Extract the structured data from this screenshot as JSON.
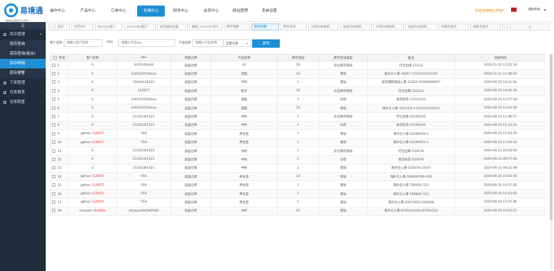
{
  "logo": {
    "name": "易境通",
    "url": "www.yejom.com"
  },
  "nav": [
    {
      "label": "操作中心"
    },
    {
      "label": "产品中心"
    },
    {
      "label": "订单中心"
    },
    {
      "label": "仓储中心"
    },
    {
      "label": "财务中心"
    },
    {
      "label": "会员中心"
    },
    {
      "label": "网站管理"
    },
    {
      "label": "系统设置"
    }
  ],
  "top_right": {
    "notice": "欢迎您使用工作台!",
    "user": "demo"
  },
  "sidebar": {
    "toggle": "☰",
    "groups": [
      {
        "label": "库存管理",
        "items": [
          {
            "label": "库存查询"
          },
          {
            "label": "库存查询(组合)"
          },
          {
            "label": "库存明细"
          },
          {
            "label": "库存预警"
          }
        ]
      },
      {
        "label": "下架管理"
      },
      {
        "label": "仓库报表"
      },
      {
        "label": "仓库配置"
      }
    ]
  },
  "tabs": [
    {
      "label": "首页"
    },
    {
      "label": "店店API"
    },
    {
      "label": "Stamps账户"
    },
    {
      "label": "sunzeallu账户"
    },
    {
      "label": "发货编码设置"
    },
    {
      "label": "编辑_sunzeal-001"
    },
    {
      "label": "库存预警"
    },
    {
      "label": "库存明细"
    },
    {
      "label": "库存查询"
    },
    {
      "label": "头程价格规则"
    },
    {
      "label": "运送方式规则"
    },
    {
      "label": "头程价格规则"
    },
    {
      "label": "运送方式规则"
    },
    {
      "label": "待收货批次"
    },
    {
      "label": "待拣货批次"
    }
  ],
  "filters": {
    "customer_label": "客户名称",
    "customer_placeholder": "请输入客户名称",
    "sku_label": "SKU",
    "sku_placeholder": "请输入产品sku",
    "product_label": "产品名称",
    "product_placeholder": "请输入产品名称",
    "category_value": "全部分类",
    "query_label": "查询"
  },
  "table": {
    "headers": [
      "序号",
      "客户名称",
      "sku",
      "所属仓库",
      "产品名称",
      "库存变动",
      "库存变动类型",
      "备注",
      "添加时间"
    ],
    "rows": [
      {
        "seq": "1",
        "customer": "0",
        "code": "",
        "sku": "3415544444",
        "wh": "美国仓库",
        "name": "44",
        "qty": "10",
        "type": "乐信库存扣除",
        "note": "打包出库-12312",
        "time": "2019-11-01 12:02:16"
      },
      {
        "seq": "2",
        "customer": "0",
        "code": "",
        "sku": "2345245534aaa",
        "wh": "美国仓库",
        "name": "电脑",
        "qty": "10",
        "type": "增加",
        "note": "海外仓入库-36457-1231231231321",
        "time": "2019-11-01 11:46:02"
      },
      {
        "seq": "3",
        "customer": "0",
        "code": "",
        "sku": "2344dc34233",
        "wh": "美国仓库",
        "name": "手机",
        "qty": "1",
        "type": "增加",
        "note": "退货销售增加入库-12312-10000000007",
        "time": "2019-09-25 14:11:54"
      },
      {
        "seq": "4",
        "customer": "0",
        "code": "",
        "sku": "123677",
        "wh": "美国仓库",
        "name": "鞋子",
        "qty": "10",
        "type": "乐信库存扣除",
        "note": "打包出库-123213",
        "time": "2019-09-25 14:06:18"
      },
      {
        "seq": "5",
        "customer": "0",
        "code": "",
        "sku": "2345245534aaa",
        "wh": "美国仓库",
        "name": "电脑",
        "qty": "5",
        "type": "冻结",
        "note": "发货标签-12321433",
        "time": "2019-09-25 13:57:58"
      },
      {
        "seq": "6",
        "customer": "0",
        "code": "",
        "sku": "2345245534aaa",
        "wh": "美国仓库",
        "name": "电脑",
        "qty": "10",
        "type": "增加",
        "note": "海外仓入库-32213213-131231232213",
        "time": "2019-09-25 13:54:18"
      },
      {
        "seq": "7",
        "customer": "0",
        "code": "",
        "sku": "21343345321",
        "wh": "美国仓库",
        "name": "中秋",
        "qty": "1",
        "type": "乐信库存扣除",
        "note": "打包出库-20190202",
        "time": "2019-09-23 11:46:57"
      },
      {
        "seq": "8",
        "customer": "0",
        "code": "",
        "sku": "21343345321",
        "wh": "美国仓库",
        "name": "中秋",
        "qty": "1",
        "type": "冻结",
        "note": "发货标签-20190202",
        "time": "2019-09-23 11:34:31"
      },
      {
        "seq": "9",
        "customer": "jgthwc",
        "code": "(12007)",
        "sku": "YSH",
        "wh": "美国仓库",
        "name": "养生壶",
        "qty": "1",
        "type": "增加",
        "note": "海外仓入库-20190202-1",
        "time": "2019-09-23 11:20:55"
      },
      {
        "seq": "10",
        "customer": "jgthwc",
        "code": "(12007)",
        "sku": "YSH",
        "wh": "美国仓库",
        "name": "养生壶",
        "qty": "1",
        "type": "增加",
        "note": "海外仓入库-20190921-1",
        "time": "2019-09-23 11:09:22"
      },
      {
        "seq": "11",
        "customer": "0",
        "code": "",
        "sku": "21343345321",
        "wh": "美国仓库",
        "name": "中秋",
        "qty": "1",
        "type": "乐信库存扣除",
        "note": "打包出库-532678",
        "time": "2019-09-21 10:28:56"
      },
      {
        "seq": "12",
        "customer": "0",
        "code": "",
        "sku": "21343345321",
        "wh": "美国仓库",
        "name": "中秋",
        "qty": "1",
        "type": "冻结",
        "note": "发货标签-532678",
        "time": "2019-09-21 09:57:49"
      },
      {
        "seq": "13",
        "customer": "0",
        "code": "",
        "sku": "21343345321",
        "wh": "美国仓库",
        "name": "中秋",
        "qty": "2",
        "type": "增加",
        "note": "海外仓入库-532678-13547",
        "time": "2019-09-21 09:32:49"
      },
      {
        "seq": "14",
        "customer": "jgthwc",
        "code": "(12007)",
        "sku": "YSH",
        "wh": "美国仓库",
        "name": "养生壶",
        "qty": "10",
        "type": "增加",
        "note": "海外仓入库-566000789-456",
        "time": "2019-09-20 15:03:36"
      },
      {
        "seq": "15",
        "customer": "jgthwc",
        "code": "(12007)",
        "sku": "YSH",
        "wh": "美国仓库",
        "name": "养生壶",
        "qty": "1",
        "type": "增加",
        "note": "海外仓入库-789456-123",
        "time": "2019-09-20 14:57:28"
      },
      {
        "seq": "16",
        "customer": "jgthwc",
        "code": "(12007)",
        "sku": "YSH",
        "wh": "美国仓库",
        "name": "养生壶",
        "qty": "1",
        "type": "增加",
        "note": "海外仓入库-566000-123",
        "time": "2019-09-20 14:43:03"
      },
      {
        "seq": "17",
        "customer": "jgthwc",
        "code": "(12007)",
        "sku": "YSH",
        "wh": "美国仓库",
        "name": "养生壶",
        "qty": "1",
        "type": "增加",
        "note": "海外仓入库-45678923-245698",
        "time": "2019-09-20 11:05:46"
      },
      {
        "seq": "18",
        "customer": "chenwei",
        "code": "(12000)",
        "sku": "zhiyijuan84395940",
        "wh": "美国仓库",
        "name": "水杯",
        "qty": "53",
        "type": "增加",
        "note": "海外仓入库-8765433324-87654354",
        "time": "2019-09-20 10:55:57"
      }
    ]
  }
}
